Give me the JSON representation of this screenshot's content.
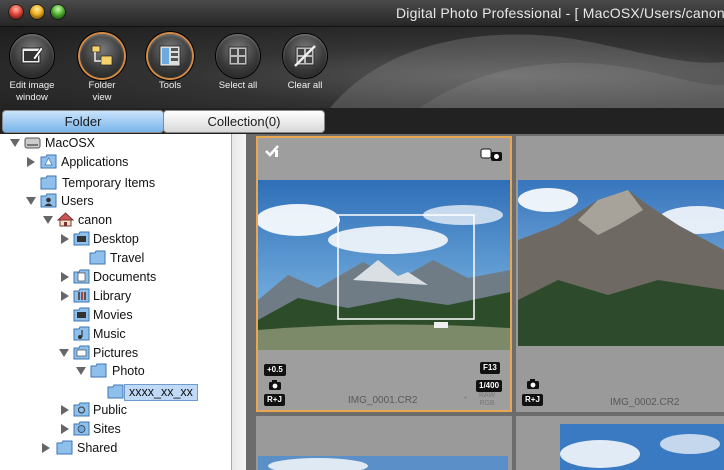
{
  "window": {
    "title": "Digital Photo Professional - [ MacOSX/Users/canon/"
  },
  "toolbar": {
    "buttons": [
      {
        "label_line1": "Edit image",
        "label_line2": "window",
        "icon": "edit-image-icon"
      },
      {
        "label_line1": "Folder",
        "label_line2": "view",
        "icon": "folder-view-icon"
      },
      {
        "label_line1": "Tools",
        "label_line2": "",
        "icon": "tools-icon"
      },
      {
        "label_line1": "Select all",
        "label_line2": "",
        "icon": "select-all-icon"
      },
      {
        "label_line1": "Clear all",
        "label_line2": "",
        "icon": "clear-all-icon"
      }
    ]
  },
  "tabs": {
    "folder": "Folder",
    "collection": "Collection(0)"
  },
  "tree": {
    "macosx": "MacOSX",
    "applications": "Applications",
    "temporary_items": "Temporary Items",
    "users": "Users",
    "canon": "canon",
    "desktop": "Desktop",
    "travel": "Travel",
    "documents": "Documents",
    "library": "Library",
    "movies": "Movies",
    "music": "Music",
    "pictures": "Pictures",
    "photo": "Photo",
    "xxxx": "xxxx_xx_xx",
    "public": "Public",
    "sites": "Sites",
    "shared": "Shared"
  },
  "thumbnails": [
    {
      "filename": "IMG_0001.CR2",
      "exposure_comp": "+0.5",
      "aperture": "F13",
      "shutter": "1/400",
      "quality": "R+J",
      "raw_line1": "RAW",
      "raw_line2": "RGB",
      "star": "*"
    },
    {
      "filename": "IMG_0002.CR2",
      "quality": "R+J"
    }
  ],
  "colors": {
    "selection_border": "#e9a752",
    "tab_active": "#7ab5ea",
    "tree_selection": "#bfd9f6"
  }
}
